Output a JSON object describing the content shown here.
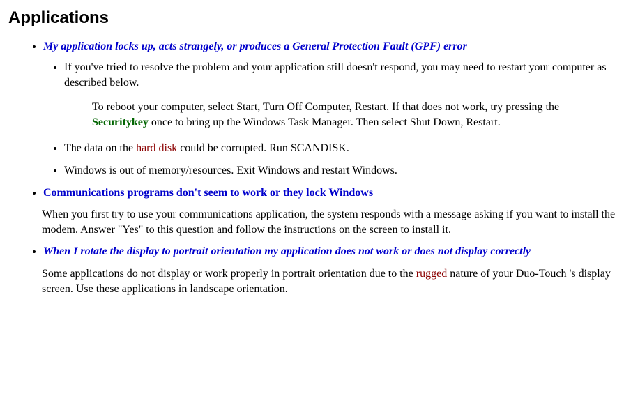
{
  "heading": "Applications",
  "q1": {
    "title": "My application locks up, acts strangely, or produces a General Protection Fault (GPF) error",
    "b1_a": "If you've tried to resolve the problem and your application still doesn't respond, you may need to restart your computer as described below.",
    "b1_b_pre": "To reboot your computer, select Start, Turn Off Computer, Restart.  If that does not work, try pressing the ",
    "b1_b_key": "Securitykey",
    "b1_b_post": " once to bring up the Windows Task Manager. Then select Shut Down, Restart.",
    "b2_pre": "The data on the ",
    "b2_link": "hard disk",
    "b2_post": " could be corrupted.  Run SCANDISK.",
    "b3": "Windows is out of memory/resources. Exit Windows and restart Windows."
  },
  "q2": {
    "title": "Communications programs don't seem to work or they lock Windows",
    "body": "When you first try to use your communications application, the system responds with a message asking if you want to install the modem. Answer \"Yes\" to this question and follow the instructions on the screen to install it."
  },
  "q3": {
    "title": "When I rotate the display to portrait orientation my application does not work or does not display correctly",
    "body_pre": "Some applications do not display or work properly in portrait orientation due to the ",
    "body_link": "rugged",
    "body_post": " nature of your Duo-Touch 's display screen.  Use these applications in landscape orientation."
  }
}
